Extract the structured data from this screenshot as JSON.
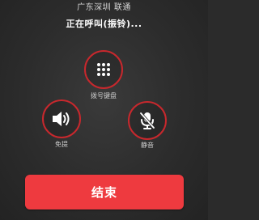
{
  "header": {
    "caller_location": "广东深圳 联通",
    "call_status": "正在呼叫(振铃)..."
  },
  "controls": {
    "dialpad": {
      "label": "拨号键盘",
      "icon": "dialpad-icon"
    },
    "speaker": {
      "label": "免提",
      "icon": "speaker-icon"
    },
    "mute": {
      "label": "静音",
      "icon": "mic-muted-icon"
    }
  },
  "end_call": {
    "label": "结束"
  },
  "colors": {
    "accent_red": "#ee3a3f",
    "ring_red": "#c8282d",
    "background": "#2c2c2c"
  }
}
